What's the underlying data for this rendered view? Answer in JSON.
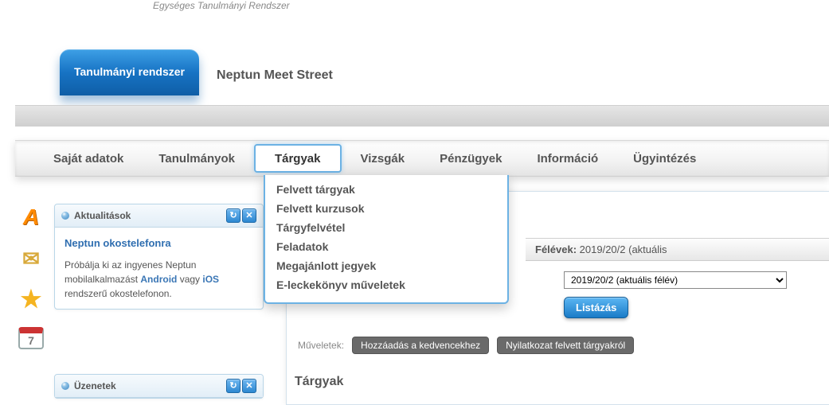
{
  "logo_subtitle": "Egységes Tanulmányi Rendszer",
  "top_tabs": {
    "active": "Tanulmányi rendszer",
    "inactive": "Neptun Meet Street"
  },
  "menu": [
    "Saját adatok",
    "Tanulmányok",
    "Tárgyak",
    "Vizsgák",
    "Pénzügyek",
    "Információ",
    "Ügyintézés"
  ],
  "dropdown": [
    "Felvett tárgyak",
    "Felvett kurzusok",
    "Tárgyfelvétel",
    "Feladatok",
    "Megajánlott jegyek",
    "E-leckekönyv műveletek"
  ],
  "widgets": {
    "news": {
      "title": "Aktualitások",
      "headline": "Neptun okostelefonra",
      "text_pre": "Próbálja ki az ingyenes Neptun mobilalkalmazást ",
      "link1": "Android",
      "mid": " vagy ",
      "link2": "iOS",
      "text_post": " rendszerű okostelefonon."
    },
    "messages": {
      "title": "Üzenetek"
    }
  },
  "content": {
    "semesters_label": "Félévek:",
    "semesters_value": "2019/20/2 (aktuális",
    "select_value": "2019/20/2 (aktuális félév)",
    "list_btn": "Listázás",
    "ops_label": "Műveletek:",
    "btn_fav": "Hozzáadás a kedvencekhez",
    "btn_decl": "Nyilatkozat felvett tárgyakról",
    "section": "Tárgyak"
  },
  "cal_day": "7"
}
